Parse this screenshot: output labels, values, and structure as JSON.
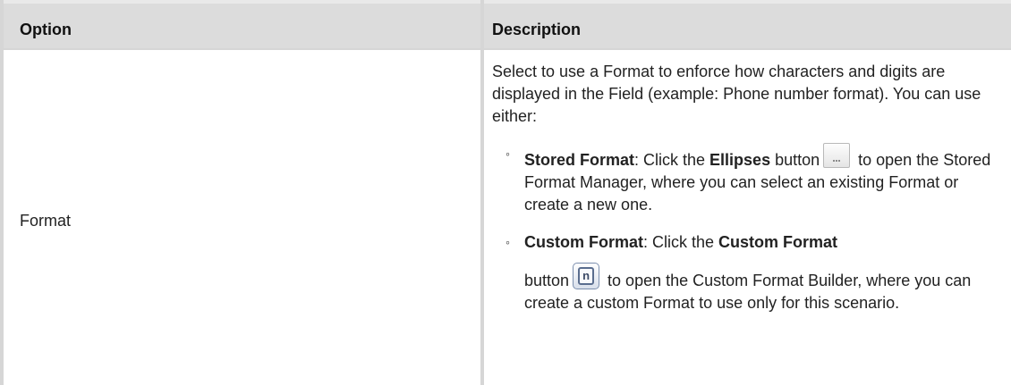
{
  "table": {
    "headers": {
      "option": "Option",
      "description": "Description"
    },
    "rows": [
      {
        "option": "Format",
        "description_intro": "Select to use a Format to enforce how characters and digits are displayed in the Field (example: Phone number format). You can use either:",
        "bullets": [
          {
            "title": "Stored Format",
            "text_before_button": ": Click the ",
            "button_name": "Ellipses",
            "text_after_button_name": " button",
            "icon": "ellipses-icon",
            "text_after_icon": " to open the Stored Format Manager, where you can select an existing Format or create a new one."
          },
          {
            "title": "Custom Format",
            "text_before_button": ": Click the ",
            "button_name": "Custom Format",
            "text_after_button_name": "button",
            "icon": "custom-format-icon",
            "icon_glyph": "n",
            "text_after_icon": " to open the Custom Format Builder, where you can create a custom Format to use only for this scenario."
          }
        ]
      }
    ]
  },
  "colors": {
    "header_background": "#dcdcdc",
    "border": "#d6d6d6"
  }
}
